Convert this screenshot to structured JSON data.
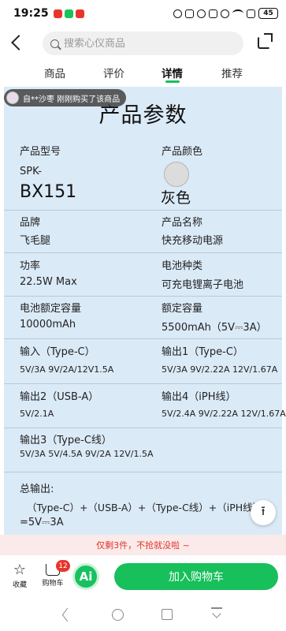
{
  "status_bar": {
    "time": "19:25",
    "battery": "45",
    "app_colors": [
      "#e8352b",
      "#19c25c",
      "#e8352b"
    ]
  },
  "header": {
    "search_placeholder": "搜索心仪商品"
  },
  "tabs": [
    {
      "label": "商品"
    },
    {
      "label": "评价"
    },
    {
      "label": "详情"
    },
    {
      "label": "推荐"
    }
  ],
  "active_tab": "详情",
  "toast": {
    "text": "自**沙枣 刚刚购买了该商品"
  },
  "spec_sheet": {
    "title": "产品参数",
    "model_label": "产品型号",
    "model_prefix": "SPK-",
    "model_value": "BX151",
    "color_label": "产品颜色",
    "color_value": "灰色",
    "brand_label": "品牌",
    "brand_value": "飞毛腿",
    "name_label": "产品名称",
    "name_value": "快充移动电源",
    "power_label": "功率",
    "power_value": "22.5W Max",
    "battery_type_label": "电池种类",
    "battery_type_value": "可充电锂离子电池",
    "rated_capacity_label": "电池额定容量",
    "rated_capacity_value": "10000mAh",
    "capacity_label": "额定容量",
    "capacity_value": "5500mAh（5V⎓3A）",
    "input_label": "输入（Type-C）",
    "input_value": "5V/3A 9V/2A/12V1.5A",
    "output1_label": "输出1（Type-C）",
    "output1_value": "5V/3A 9V/2.22A 12V/1.67A",
    "output2_label": "输出2（USB-A）",
    "output2_value": "5V/2.1A",
    "output4_label": "输出4（iPH线）",
    "output4_value": "5V/2.4A 9V/2.22A 12V/1.67A",
    "output3_label": "输出3（Type-C线）",
    "output3_value": "5V/3A 5V/4.5A 9V/2A 12V/1.5A",
    "total_label": "总输出:",
    "total_line1": "（Type-C）+（USB-A）+（Type-C线）+（iPH线）",
    "total_line2": "=5V⎓3A"
  },
  "promo": {
    "text": "仅剩3件，不抢就没啦 ~"
  },
  "bottom_bar": {
    "favorite_label": "收藏",
    "cart_label": "购物车",
    "cart_count": "12",
    "ai_label": "Ai",
    "add_to_cart_label": "加入购物车",
    "accent_color": "#17c05a"
  }
}
